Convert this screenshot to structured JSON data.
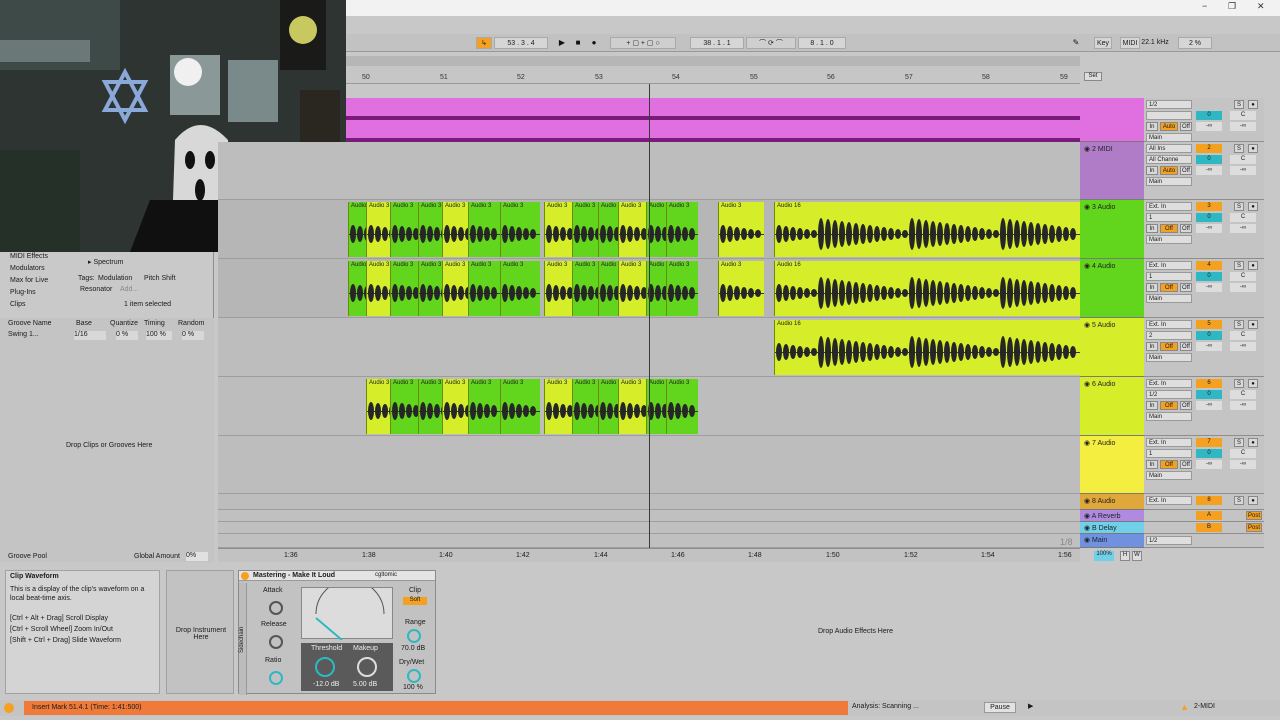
{
  "transport": {
    "follow_button": "↳",
    "song_position": "53 .   3 .   4",
    "loop_start": "38 .   1 .   1",
    "loop_length": "8 .   1 .   0",
    "key_label": "Key",
    "midi_label": "MIDI",
    "sample_rate": "22.1 kHz",
    "cpu": "2 %"
  },
  "ruler": {
    "bars": [
      "50",
      "51",
      "52",
      "53",
      "54",
      "55",
      "56",
      "57",
      "58",
      "59"
    ],
    "set_label": "Set"
  },
  "time_ruler": {
    "times": [
      "1:36",
      "1:38",
      "1:40",
      "1:42",
      "1:44",
      "1:46",
      "1:48",
      "1:50",
      "1:52",
      "1:54",
      "1:56"
    ],
    "zoom": "1/8",
    "scale": "100%",
    "h_label": "H",
    "w_label": "W"
  },
  "browser": {
    "items": [
      "MIDI Effects",
      "Modulators",
      "Max for Live",
      "Plug-Ins",
      "Clips"
    ],
    "spectrum_label": "Spectrum",
    "tags_label": "Tags:",
    "tags": [
      "Modulation",
      "Pitch Shift",
      "Resonator",
      "Add..."
    ],
    "selected_info": "1 item selected"
  },
  "groove": {
    "columns": [
      "Groove Name",
      "Base",
      "Quantize",
      "Timing",
      "Random"
    ],
    "row": {
      "name": "Swing 1...",
      "base": "1/16",
      "quantize": "0 %",
      "timing": "100 %",
      "random": "0 %"
    },
    "drop_hint": "Drop Clips or Grooves Here",
    "pool_label": "Groove Pool",
    "global_amount_label": "Global Amount",
    "global_amount_value": "0%"
  },
  "tracks": [
    {
      "name": "",
      "number": "",
      "color": "#e070e0",
      "input": "1/2",
      "channel": "",
      "monitor": "Auto"
    },
    {
      "name": "2 MIDI",
      "number": "2",
      "color": "#b07cc8",
      "input": "All Ins",
      "channel": "All Channe",
      "monitor": "Auto"
    },
    {
      "name": "3 Audio",
      "number": "3",
      "color": "#61d61d",
      "input": "Ext. In",
      "channel": "1",
      "monitor": "Off"
    },
    {
      "name": "4 Audio",
      "number": "4",
      "color": "#61d61d",
      "input": "Ext. In",
      "channel": "1",
      "monitor": "Off"
    },
    {
      "name": "5 Audio",
      "number": "5",
      "color": "#d6ee2a",
      "input": "Ext. In",
      "channel": "2",
      "monitor": "Off"
    },
    {
      "name": "6 Audio",
      "number": "6",
      "color": "#d6ee2a",
      "input": "Ext. In",
      "channel": "1/2",
      "monitor": "Off"
    },
    {
      "name": "7 Audio",
      "number": "7",
      "color": "#f4ee40",
      "input": "Ext. In",
      "channel": "1",
      "monitor": "Off"
    },
    {
      "name": "8 Audio",
      "number": "8",
      "color": "#e0a83a",
      "input": "Ext. In",
      "channel": "",
      "monitor": ""
    }
  ],
  "returns": [
    {
      "name": "A Reverb",
      "letter": "A",
      "color": "#b08ae0"
    },
    {
      "name": "B Delay",
      "letter": "B",
      "color": "#70d0e8"
    },
    {
      "name": "Main",
      "letter": "",
      "color": "#7090e0"
    }
  ],
  "mixer": {
    "main_out": "Main",
    "in_label": "In",
    "off_label": "Off",
    "vol_value": "0",
    "pan_value": "C",
    "send_value": "-∞",
    "s_label": "S",
    "post_label": "Post"
  },
  "clip_names": {
    "audio3": "Audio 3",
    "audio": "Audio",
    "audio16": "Audio 16"
  },
  "info_view": {
    "title": "Clip Waveform",
    "body": "This is a display of the clip's waveform on a local beat-time axis.",
    "shortcuts": [
      "[Ctrl + Alt + Drag] Scroll Display",
      "[Ctrl + Scroll Wheel] Zoom In/Out",
      "[Shift + Ctrl + Drag] Slide Waveform"
    ]
  },
  "device": {
    "title": "Mastering - Make It Loud",
    "brand": "cgltomic",
    "attack_label": "Attack",
    "release_label": "Release",
    "ratio_label": "Ratio",
    "clip_label": "Clip",
    "soft_label": "Soft",
    "threshold_label": "Threshold",
    "threshold_value": "-12.0 dB",
    "makeup_label": "Makeup",
    "makeup_value": "5.00 dB",
    "range_label": "Range",
    "range_value": "70.0 dB",
    "drywet_label": "Dry/Wet",
    "drywet_value": "100 %",
    "sidechain_label": "Sidechain",
    "instrument_drop": "Drop Instrument Here",
    "effects_drop": "Drop Audio Effects Here"
  },
  "status": {
    "message": "Insert Mark 51.4.1 (Time: 1:41:500)",
    "analysis": "Analysis: Scanning ...",
    "pause": "Pause",
    "track_selector": "2-MIDI"
  },
  "colors": {
    "audio_green": "#61d61d",
    "audio_yellow": "#d6ee2a",
    "midi_pink": "#e070e0",
    "status_orange": "#f07a3a",
    "accent_orange": "#f4a020",
    "knob_teal": "#2fb8c4"
  }
}
